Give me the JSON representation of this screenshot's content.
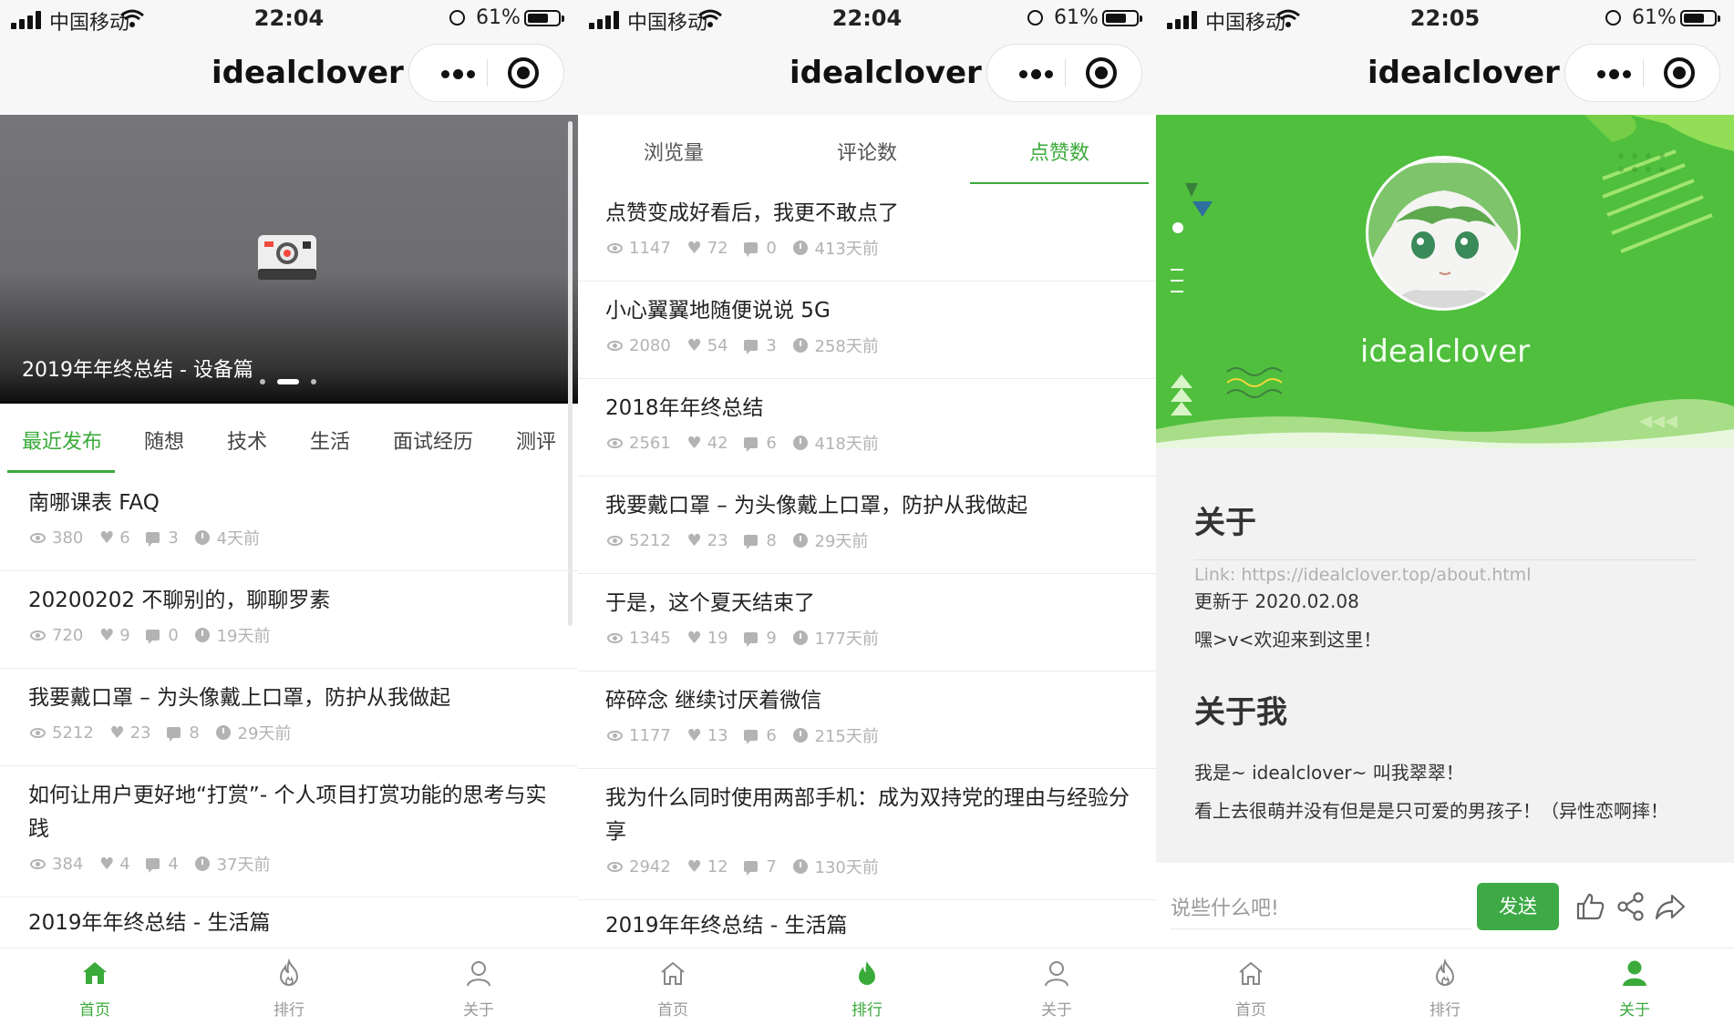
{
  "status_bars": [
    {
      "carrier": "中国移动",
      "time": "22:04",
      "battery": "61%"
    },
    {
      "carrier": "中国移动",
      "time": "22:04",
      "battery": "61%"
    },
    {
      "carrier": "中国移动",
      "time": "22:05",
      "battery": "61%"
    }
  ],
  "app_title": "idealclover",
  "tabbar": {
    "home": "首页",
    "rank": "排行",
    "about": "关于"
  },
  "home": {
    "banner_caption": "2019年年终总结 - 设备篇",
    "categories": [
      "最近发布",
      "随想",
      "技术",
      "生活",
      "面试经历",
      "测评"
    ],
    "posts": [
      {
        "title": "南哪课表 FAQ",
        "views": "380",
        "likes": "6",
        "comments": "3",
        "time": "4天前"
      },
      {
        "title": "20200202 不聊别的，聊聊罗素",
        "views": "720",
        "likes": "9",
        "comments": "0",
        "time": "19天前"
      },
      {
        "title": "我要戴口罩 – 为头像戴上口罩，防护从我做起",
        "views": "5212",
        "likes": "23",
        "comments": "8",
        "time": "29天前"
      },
      {
        "title": "如何让用户更好地“打赏”- 个人项目打赏功能的思考与实践",
        "views": "384",
        "likes": "4",
        "comments": "4",
        "time": "37天前"
      },
      {
        "title": "2019年年终总结 - 生活篇"
      }
    ]
  },
  "rank": {
    "tabs": [
      "浏览量",
      "评论数",
      "点赞数"
    ],
    "posts": [
      {
        "title": "点赞变成好看后，我更不敢点了",
        "views": "1147",
        "likes": "72",
        "comments": "0",
        "time": "413天前"
      },
      {
        "title": "小心翼翼地随便说说 5G",
        "views": "2080",
        "likes": "54",
        "comments": "3",
        "time": "258天前"
      },
      {
        "title": "2018年年终总结",
        "views": "2561",
        "likes": "42",
        "comments": "6",
        "time": "418天前"
      },
      {
        "title": "我要戴口罩 – 为头像戴上口罩，防护从我做起",
        "views": "5212",
        "likes": "23",
        "comments": "8",
        "time": "29天前"
      },
      {
        "title": "于是，这个夏天结束了",
        "views": "1345",
        "likes": "19",
        "comments": "9",
        "time": "177天前"
      },
      {
        "title": "碎碎念 继续讨厌着微信",
        "views": "1177",
        "likes": "13",
        "comments": "6",
        "time": "215天前"
      },
      {
        "title": "我为什么同时使用两部手机：成为双持党的理由与经验分享",
        "views": "2942",
        "likes": "12",
        "comments": "7",
        "time": "130天前"
      },
      {
        "title": "2019年年终总结 - 生活篇"
      }
    ]
  },
  "about": {
    "name": "idealclover",
    "heading1": "关于",
    "link": "Link: https://idealclover.top/about.html",
    "updated": "更新于 2020.02.08",
    "welcome": "嘿>v<欢迎来到这里！",
    "heading2": "关于我",
    "intro1": "我是~ idealclover~ 叫我翠翠！",
    "intro2": "看上去很萌并没有但是是只可爱的男孩子！（异性恋啊摔！",
    "comment_placeholder": "说些什么吧!",
    "send": "发送"
  },
  "colors": {
    "accent": "#3aaa3a",
    "hero_green": "#4fbf3d",
    "meta_gray": "#b3b3b3"
  }
}
